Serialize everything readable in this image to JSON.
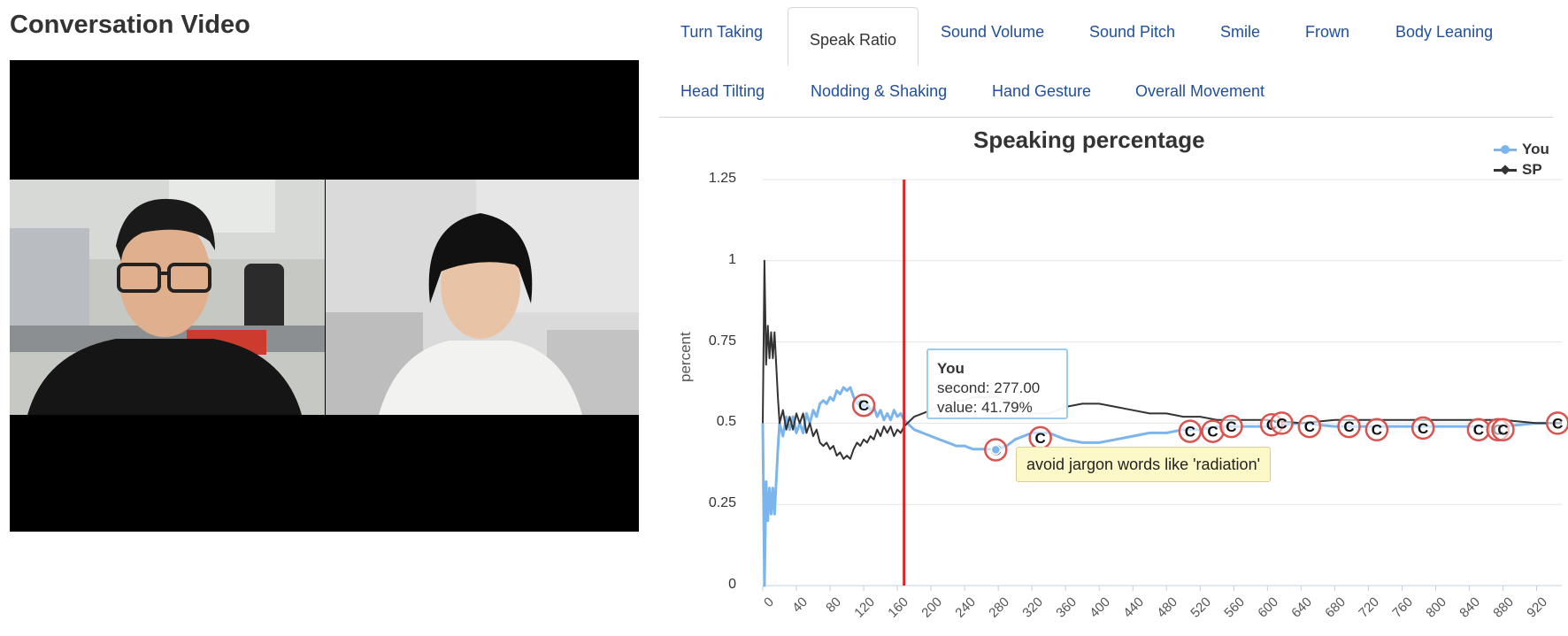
{
  "page": {
    "title": "Conversation Video"
  },
  "tabs": [
    {
      "label": "Turn Taking",
      "active": false
    },
    {
      "label": "Speak Ratio",
      "active": true
    },
    {
      "label": "Sound Volume",
      "active": false
    },
    {
      "label": "Sound Pitch",
      "active": false
    },
    {
      "label": "Smile",
      "active": false
    },
    {
      "label": "Frown",
      "active": false
    },
    {
      "label": "Body Leaning",
      "active": false
    },
    {
      "label": "Head Tilting",
      "active": false
    },
    {
      "label": "Nodding & Shaking",
      "active": false
    },
    {
      "label": "Hand Gesture",
      "active": false
    },
    {
      "label": "Overall Movement",
      "active": false
    }
  ],
  "tooltip": {
    "series": "You",
    "second_line": "second: 277.00",
    "value_line": "value: 41.79%"
  },
  "note": {
    "text": "avoid jargon words like 'radiation'"
  },
  "comment_marker_label": "C",
  "colors": {
    "you": "#7cb5ec",
    "sp": "#333333",
    "current_time_line": "#d62728",
    "marker_ring": "#d9534f",
    "tab_link": "#20509c"
  },
  "chart_data": {
    "type": "line",
    "title": "Speaking percentage",
    "ylabel": "percent",
    "xlabel": "",
    "ylim": [
      0,
      1.25
    ],
    "xlim": [
      0,
      950
    ],
    "y_ticks": [
      "0",
      "0.25",
      "0.5",
      "0.75",
      "1",
      "1.25"
    ],
    "y_tick_values": [
      0,
      0.25,
      0.5,
      0.75,
      1,
      1.25
    ],
    "x_ticks": [
      "0",
      "40",
      "80",
      "120",
      "160",
      "200",
      "240",
      "280",
      "320",
      "360",
      "400",
      "440",
      "480",
      "520",
      "560",
      "600",
      "640",
      "680",
      "720",
      "760",
      "800",
      "840",
      "880",
      "920"
    ],
    "legend_position": "top-right",
    "current_time": 168,
    "series": [
      {
        "name": "You",
        "color": "#7cb5ec",
        "points": [
          [
            0,
            0.5
          ],
          [
            2,
            0.0
          ],
          [
            4,
            0.32
          ],
          [
            6,
            0.2
          ],
          [
            8,
            0.3
          ],
          [
            10,
            0.22
          ],
          [
            12,
            0.3
          ],
          [
            14,
            0.22
          ],
          [
            16,
            0.32
          ],
          [
            18,
            0.42
          ],
          [
            20,
            0.5
          ],
          [
            24,
            0.46
          ],
          [
            28,
            0.52
          ],
          [
            32,
            0.48
          ],
          [
            36,
            0.52
          ],
          [
            40,
            0.47
          ],
          [
            44,
            0.5
          ],
          [
            48,
            0.47
          ],
          [
            52,
            0.53
          ],
          [
            56,
            0.5
          ],
          [
            60,
            0.54
          ],
          [
            64,
            0.52
          ],
          [
            68,
            0.56
          ],
          [
            72,
            0.57
          ],
          [
            76,
            0.56
          ],
          [
            80,
            0.58
          ],
          [
            84,
            0.57
          ],
          [
            88,
            0.6
          ],
          [
            92,
            0.59
          ],
          [
            96,
            0.61
          ],
          [
            100,
            0.6
          ],
          [
            104,
            0.61
          ],
          [
            108,
            0.58
          ],
          [
            112,
            0.56
          ],
          [
            116,
            0.57
          ],
          [
            120,
            0.55
          ],
          [
            124,
            0.56
          ],
          [
            128,
            0.54
          ],
          [
            132,
            0.55
          ],
          [
            136,
            0.52
          ],
          [
            140,
            0.54
          ],
          [
            144,
            0.51
          ],
          [
            148,
            0.53
          ],
          [
            152,
            0.51
          ],
          [
            156,
            0.54
          ],
          [
            160,
            0.52
          ],
          [
            164,
            0.53
          ],
          [
            168,
            0.51
          ],
          [
            172,
            0.5
          ],
          [
            180,
            0.48
          ],
          [
            190,
            0.47
          ],
          [
            200,
            0.46
          ],
          [
            210,
            0.45
          ],
          [
            220,
            0.44
          ],
          [
            230,
            0.43
          ],
          [
            240,
            0.43
          ],
          [
            250,
            0.42
          ],
          [
            260,
            0.42
          ],
          [
            270,
            0.42
          ],
          [
            277,
            0.4179
          ],
          [
            290,
            0.43
          ],
          [
            300,
            0.45
          ],
          [
            320,
            0.47
          ],
          [
            340,
            0.47
          ],
          [
            360,
            0.45
          ],
          [
            380,
            0.44
          ],
          [
            400,
            0.44
          ],
          [
            420,
            0.45
          ],
          [
            440,
            0.46
          ],
          [
            460,
            0.47
          ],
          [
            480,
            0.47
          ],
          [
            500,
            0.48
          ],
          [
            520,
            0.48
          ],
          [
            540,
            0.49
          ],
          [
            560,
            0.49
          ],
          [
            580,
            0.49
          ],
          [
            600,
            0.49
          ],
          [
            640,
            0.5
          ],
          [
            680,
            0.49
          ],
          [
            720,
            0.49
          ],
          [
            760,
            0.49
          ],
          [
            800,
            0.49
          ],
          [
            840,
            0.49
          ],
          [
            880,
            0.49
          ],
          [
            920,
            0.5
          ],
          [
            950,
            0.5
          ]
        ]
      },
      {
        "name": "SP",
        "color": "#333333",
        "points": [
          [
            0,
            0.5
          ],
          [
            2,
            1.0
          ],
          [
            4,
            0.68
          ],
          [
            6,
            0.8
          ],
          [
            8,
            0.7
          ],
          [
            10,
            0.78
          ],
          [
            12,
            0.7
          ],
          [
            14,
            0.78
          ],
          [
            16,
            0.68
          ],
          [
            18,
            0.58
          ],
          [
            20,
            0.5
          ],
          [
            24,
            0.54
          ],
          [
            28,
            0.48
          ],
          [
            32,
            0.52
          ],
          [
            36,
            0.48
          ],
          [
            40,
            0.53
          ],
          [
            44,
            0.5
          ],
          [
            48,
            0.53
          ],
          [
            52,
            0.47
          ],
          [
            56,
            0.5
          ],
          [
            60,
            0.46
          ],
          [
            64,
            0.48
          ],
          [
            68,
            0.44
          ],
          [
            72,
            0.43
          ],
          [
            76,
            0.44
          ],
          [
            80,
            0.42
          ],
          [
            84,
            0.43
          ],
          [
            88,
            0.4
          ],
          [
            92,
            0.41
          ],
          [
            96,
            0.39
          ],
          [
            100,
            0.4
          ],
          [
            104,
            0.39
          ],
          [
            108,
            0.42
          ],
          [
            112,
            0.44
          ],
          [
            116,
            0.43
          ],
          [
            120,
            0.45
          ],
          [
            124,
            0.44
          ],
          [
            128,
            0.46
          ],
          [
            132,
            0.45
          ],
          [
            136,
            0.48
          ],
          [
            140,
            0.46
          ],
          [
            144,
            0.49
          ],
          [
            148,
            0.47
          ],
          [
            152,
            0.49
          ],
          [
            156,
            0.46
          ],
          [
            160,
            0.48
          ],
          [
            164,
            0.47
          ],
          [
            168,
            0.49
          ],
          [
            172,
            0.5
          ],
          [
            180,
            0.52
          ],
          [
            190,
            0.53
          ],
          [
            200,
            0.54
          ],
          [
            210,
            0.55
          ],
          [
            220,
            0.56
          ],
          [
            230,
            0.57
          ],
          [
            240,
            0.57
          ],
          [
            250,
            0.58
          ],
          [
            260,
            0.58
          ],
          [
            270,
            0.58
          ],
          [
            277,
            0.5821
          ],
          [
            290,
            0.57
          ],
          [
            300,
            0.55
          ],
          [
            320,
            0.53
          ],
          [
            340,
            0.53
          ],
          [
            360,
            0.55
          ],
          [
            380,
            0.56
          ],
          [
            400,
            0.56
          ],
          [
            420,
            0.55
          ],
          [
            440,
            0.54
          ],
          [
            460,
            0.53
          ],
          [
            480,
            0.53
          ],
          [
            500,
            0.52
          ],
          [
            520,
            0.52
          ],
          [
            540,
            0.51
          ],
          [
            560,
            0.51
          ],
          [
            580,
            0.51
          ],
          [
            600,
            0.51
          ],
          [
            640,
            0.5
          ],
          [
            680,
            0.51
          ],
          [
            720,
            0.51
          ],
          [
            760,
            0.51
          ],
          [
            800,
            0.51
          ],
          [
            840,
            0.51
          ],
          [
            880,
            0.51
          ],
          [
            920,
            0.5
          ],
          [
            950,
            0.5
          ]
        ]
      }
    ],
    "comment_markers": [
      [
        120,
        0.555
      ],
      [
        277,
        0.418
      ],
      [
        330,
        0.455
      ],
      [
        508,
        0.475
      ],
      [
        535,
        0.475
      ],
      [
        557,
        0.49
      ],
      [
        605,
        0.495
      ],
      [
        617,
        0.5
      ],
      [
        650,
        0.49
      ],
      [
        697,
        0.49
      ],
      [
        730,
        0.48
      ],
      [
        785,
        0.485
      ],
      [
        851,
        0.48
      ],
      [
        874,
        0.48
      ],
      [
        880,
        0.48
      ],
      [
        945,
        0.5
      ]
    ]
  }
}
